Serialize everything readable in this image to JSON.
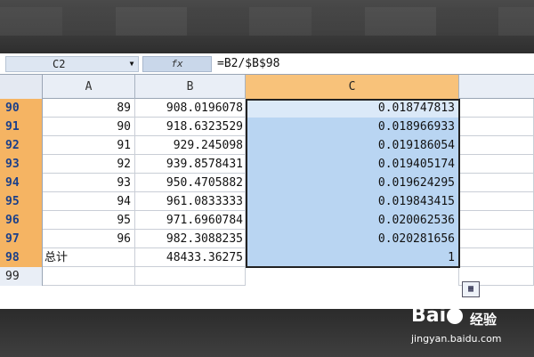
{
  "formula_bar": {
    "name_box": "C2",
    "fx_label": "fx",
    "formula": "=B2/$B$98"
  },
  "columns": [
    "A",
    "B",
    "C"
  ],
  "rows": [
    {
      "num": "90",
      "a": "89",
      "b": "908.0196078",
      "c": "0.018747813"
    },
    {
      "num": "91",
      "a": "90",
      "b": "918.6323529",
      "c": "0.018966933"
    },
    {
      "num": "92",
      "a": "91",
      "b": "929.245098",
      "c": "0.019186054"
    },
    {
      "num": "93",
      "a": "92",
      "b": "939.8578431",
      "c": "0.019405174"
    },
    {
      "num": "94",
      "a": "93",
      "b": "950.4705882",
      "c": "0.019624295"
    },
    {
      "num": "95",
      "a": "94",
      "b": "961.0833333",
      "c": "0.019843415"
    },
    {
      "num": "96",
      "a": "95",
      "b": "971.6960784",
      "c": "0.020062536"
    },
    {
      "num": "97",
      "a": "96",
      "b": "982.3088235",
      "c": "0.020281656"
    },
    {
      "num": "98",
      "a": "总计",
      "b": "48433.36275",
      "c": "1"
    },
    {
      "num": "99",
      "a": "",
      "b": "",
      "c": ""
    }
  ],
  "watermark": {
    "brand_left": "Bai",
    "brand_right": "经验",
    "url": "jingyan.baidu.com"
  }
}
